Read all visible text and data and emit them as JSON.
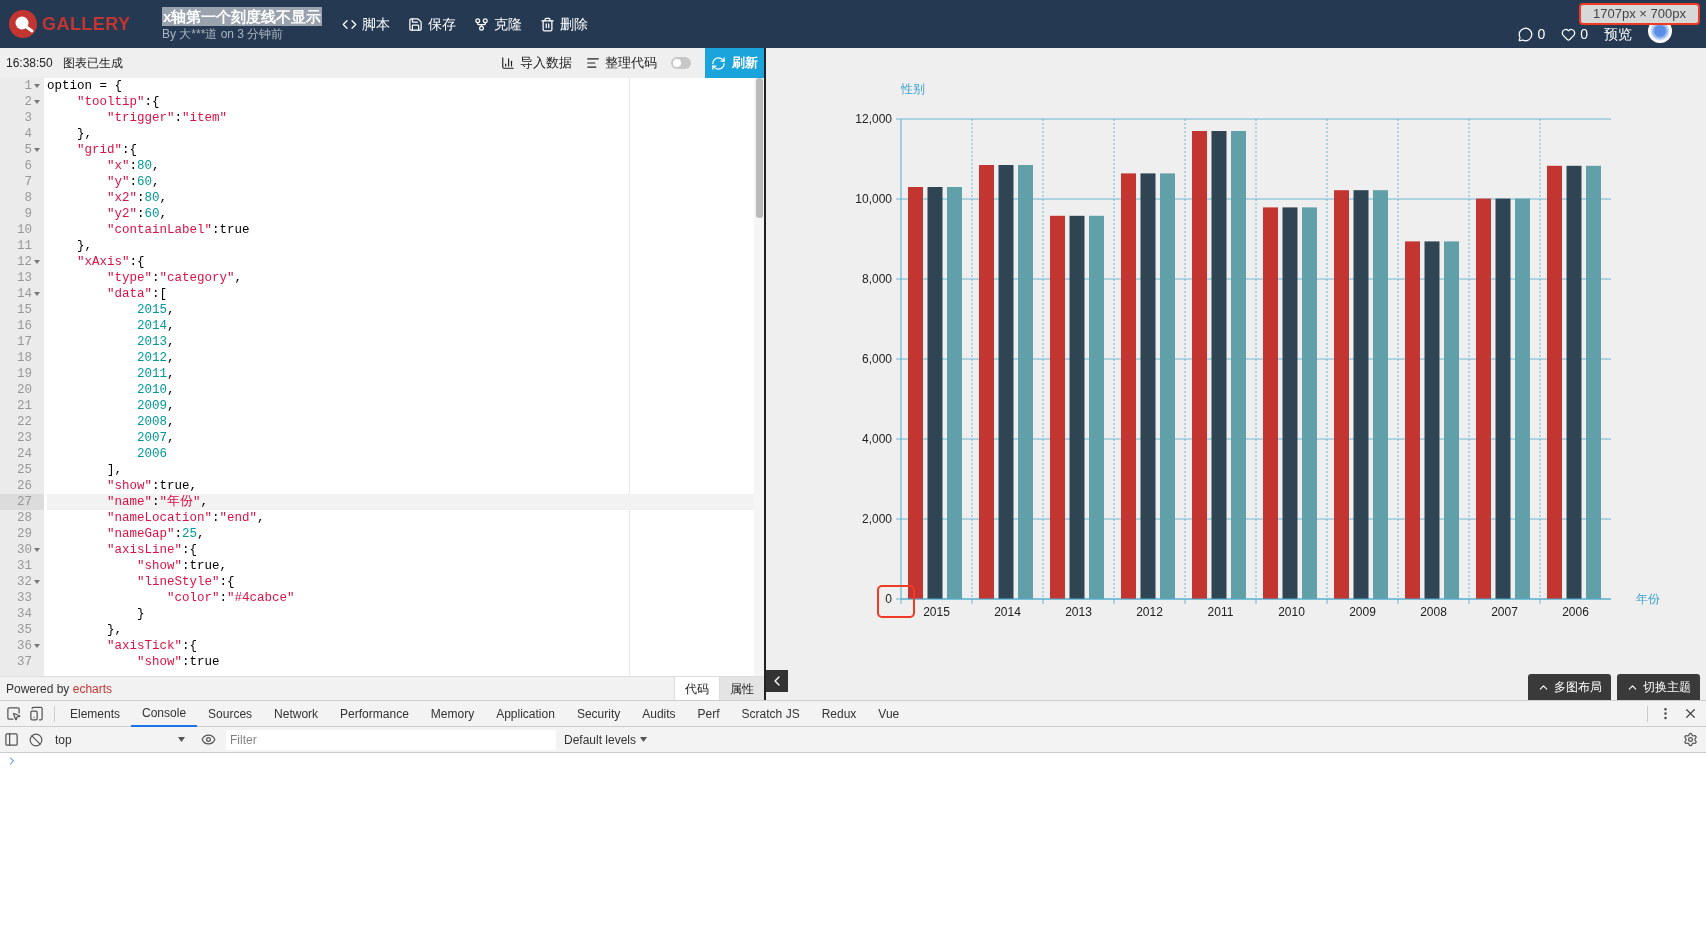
{
  "header": {
    "logo_text": "GALLERY",
    "title": "x轴第一个刻度线不显示",
    "title_highlighted": true,
    "byline": "By 大***道 on 3 分钟前",
    "actions": [
      {
        "label": "脚本"
      },
      {
        "label": "保存"
      },
      {
        "label": "克隆"
      },
      {
        "label": "删除"
      }
    ],
    "comments": "0",
    "likes": "0",
    "preview": "预览"
  },
  "size_overlay": "1707px × 700px",
  "toolbar": {
    "time": "16:38:50",
    "status": "图表已生成",
    "buttons": [
      {
        "label": "导入数据"
      },
      {
        "label": "整理代码"
      }
    ],
    "toggle_on": false,
    "refresh": "刷新"
  },
  "editor": {
    "lines": [
      {
        "number": "1",
        "text": "option = {",
        "fold": true,
        "active": false
      },
      {
        "number": "2",
        "text": "    \"tooltip\":{",
        "fold": true,
        "active": false
      },
      {
        "number": "3",
        "text": "        \"trigger\":\"item\"",
        "fold": false,
        "active": false
      },
      {
        "number": "4",
        "text": "    },",
        "fold": false,
        "active": false
      },
      {
        "number": "5",
        "text": "    \"grid\":{",
        "fold": true,
        "active": false
      },
      {
        "number": "6",
        "text": "        \"x\":80,",
        "fold": false,
        "active": false
      },
      {
        "number": "7",
        "text": "        \"y\":60,",
        "fold": false,
        "active": false
      },
      {
        "number": "8",
        "text": "        \"x2\":80,",
        "fold": false,
        "active": false
      },
      {
        "number": "9",
        "text": "        \"y2\":60,",
        "fold": false,
        "active": false
      },
      {
        "number": "10",
        "text": "        \"containLabel\":true",
        "fold": false,
        "active": false
      },
      {
        "number": "11",
        "text": "    },",
        "fold": false,
        "active": false
      },
      {
        "number": "12",
        "text": "    \"xAxis\":{",
        "fold": true,
        "active": false
      },
      {
        "number": "13",
        "text": "        \"type\":\"category\",",
        "fold": false,
        "active": false
      },
      {
        "number": "14",
        "text": "        \"data\":[",
        "fold": true,
        "active": false
      },
      {
        "number": "15",
        "text": "            2015,",
        "fold": false,
        "active": false
      },
      {
        "number": "16",
        "text": "            2014,",
        "fold": false,
        "active": false
      },
      {
        "number": "17",
        "text": "            2013,",
        "fold": false,
        "active": false
      },
      {
        "number": "18",
        "text": "            2012,",
        "fold": false,
        "active": false
      },
      {
        "number": "19",
        "text": "            2011,",
        "fold": false,
        "active": false
      },
      {
        "number": "20",
        "text": "            2010,",
        "fold": false,
        "active": false
      },
      {
        "number": "21",
        "text": "            2009,",
        "fold": false,
        "active": false
      },
      {
        "number": "22",
        "text": "            2008,",
        "fold": false,
        "active": false
      },
      {
        "number": "23",
        "text": "            2007,",
        "fold": false,
        "active": false
      },
      {
        "number": "24",
        "text": "            2006",
        "fold": false,
        "active": false
      },
      {
        "number": "25",
        "text": "        ],",
        "fold": false,
        "active": false
      },
      {
        "number": "26",
        "text": "        \"show\":true,",
        "fold": false,
        "active": false
      },
      {
        "number": "27",
        "text": "        \"name\":\"年份\",",
        "fold": false,
        "active": true
      },
      {
        "number": "28",
        "text": "        \"nameLocation\":\"end\",",
        "fold": false,
        "active": false
      },
      {
        "number": "29",
        "text": "        \"nameGap\":25,",
        "fold": false,
        "active": false
      },
      {
        "number": "30",
        "text": "        \"axisLine\":{",
        "fold": true,
        "active": false
      },
      {
        "number": "31",
        "text": "            \"show\":true,",
        "fold": false,
        "active": false
      },
      {
        "number": "32",
        "text": "            \"lineStyle\":{",
        "fold": true,
        "active": false
      },
      {
        "number": "33",
        "text": "                \"color\":\"#4cabce\"",
        "fold": false,
        "active": false
      },
      {
        "number": "34",
        "text": "            }",
        "fold": false,
        "active": false
      },
      {
        "number": "35",
        "text": "        },",
        "fold": false,
        "active": false
      },
      {
        "number": "36",
        "text": "        \"axisTick\":{",
        "fold": true,
        "active": false
      },
      {
        "number": "37",
        "text": "            \"show\":true",
        "fold": false,
        "active": false
      }
    ]
  },
  "footer": {
    "powered_by": "Powered by",
    "link": "echarts",
    "tabs": [
      {
        "label": "代码",
        "selected": true
      },
      {
        "label": "属性",
        "selected": false
      }
    ]
  },
  "chart": {
    "highlight_zero_label": true,
    "chart_data": {
      "type": "bar",
      "grid": true,
      "xlabel": "年份",
      "ylabel": "性别",
      "categories": [
        "2015",
        "2014",
        "2013",
        "2012",
        "2011",
        "2010",
        "2009",
        "2008",
        "2007",
        "2006"
      ],
      "series": [
        {
          "color": "#c23531",
          "values": [
            10300,
            10850,
            9580,
            10640,
            11700,
            9790,
            10220,
            8940,
            10010,
            10830
          ]
        },
        {
          "color": "#2f4554",
          "values": [
            10300,
            10850,
            9580,
            10640,
            11700,
            9790,
            10220,
            8940,
            10010,
            10830
          ]
        },
        {
          "color": "#61a0a8",
          "values": [
            10300,
            10850,
            9580,
            10640,
            11700,
            9790,
            10220,
            8940,
            10010,
            10830
          ]
        }
      ],
      "ylim": [
        0,
        12000
      ],
      "yticks": [
        {
          "value": 0,
          "label": "0"
        },
        {
          "value": 2000,
          "label": "2,000"
        },
        {
          "value": 4000,
          "label": "4,000"
        },
        {
          "value": 6000,
          "label": "6,000"
        },
        {
          "value": 8000,
          "label": "8,000"
        },
        {
          "value": 10000,
          "label": "10,000"
        },
        {
          "value": 12000,
          "label": "12,000"
        }
      ]
    },
    "buttons": [
      "多图布局",
      "切换主题"
    ]
  },
  "devtools": {
    "tabs": [
      {
        "label": "Elements",
        "selected": false
      },
      {
        "label": "Console",
        "selected": true
      },
      {
        "label": "Sources",
        "selected": false
      },
      {
        "label": "Network",
        "selected": false
      },
      {
        "label": "Performance",
        "selected": false
      },
      {
        "label": "Memory",
        "selected": false
      },
      {
        "label": "Application",
        "selected": false
      },
      {
        "label": "Security",
        "selected": false
      },
      {
        "label": "Audits",
        "selected": false
      },
      {
        "label": "Perf",
        "selected": false
      },
      {
        "label": "Scratch JS",
        "selected": false
      },
      {
        "label": "Redux",
        "selected": false
      },
      {
        "label": "Vue",
        "selected": false
      }
    ],
    "context": "top",
    "filter_placeholder": "Filter",
    "levels": "Default levels"
  }
}
